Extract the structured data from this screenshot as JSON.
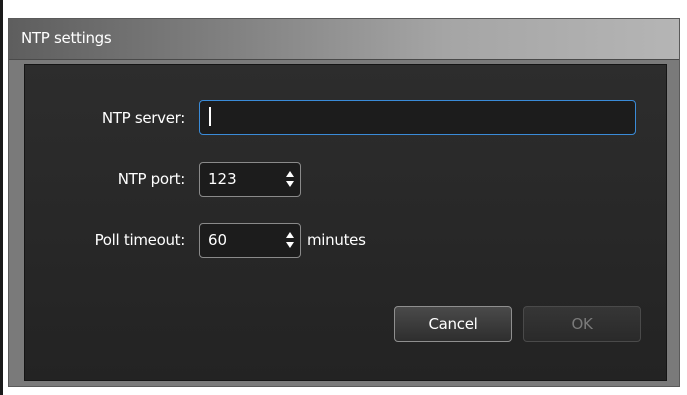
{
  "dialog": {
    "title": "NTP settings",
    "fields": {
      "server": {
        "label": "NTP server:",
        "value": ""
      },
      "port": {
        "label": "NTP port:",
        "value": "123"
      },
      "timeout": {
        "label": "Poll timeout:",
        "value": "60",
        "unit": "minutes"
      }
    },
    "buttons": {
      "cancel": "Cancel",
      "ok": "OK",
      "ok_enabled": false
    }
  },
  "colors": {
    "focus_border": "#3a8bd8",
    "panel_bg": "#2a2a2a",
    "title_text": "#ffffff"
  }
}
